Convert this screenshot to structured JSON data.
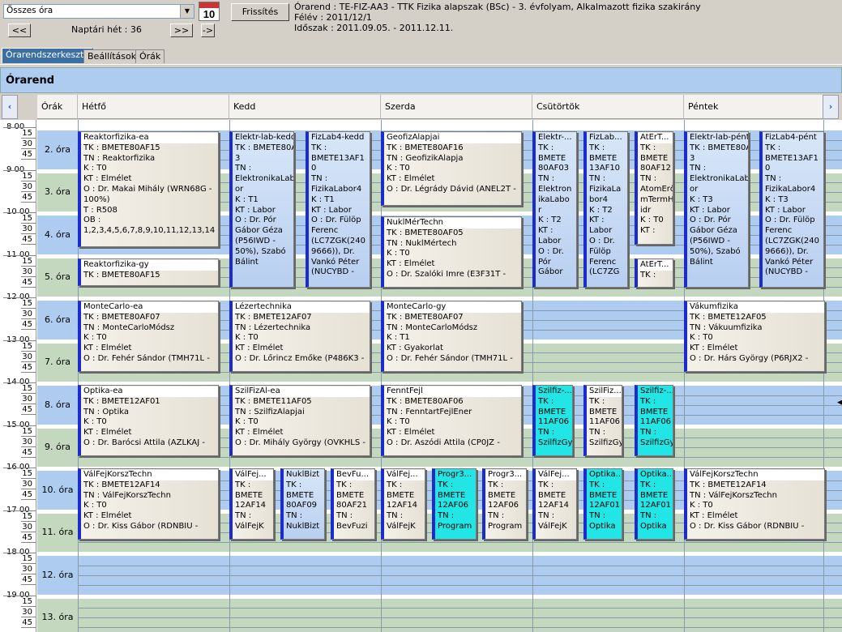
{
  "toolbar": {
    "selector_value": "Összes óra",
    "calendar_day": "10",
    "refresh_label": "Frissítés",
    "prev_label": "<<",
    "week_label": "Naptári hét : 36",
    "next_label": ">>",
    "last_label": "->"
  },
  "info": {
    "line1": "Órarend : TE-FIZ-AA3 - TTK Fizika alapszak (BSc) - 3. évfolyam, Alkalmazott fizika szakirány",
    "line2": "Félév : 2011/12/1",
    "line3": "Időszak : 2011.09.05. - 2011.12.11."
  },
  "tabs": [
    "Órarendszerkesztő",
    "Beállítások",
    "Órák"
  ],
  "title": "Órarend",
  "headers": {
    "oras": "Órák",
    "days": [
      "Hétfő",
      "Kedd",
      "Szerda",
      "Csütörtök",
      "Péntek"
    ]
  },
  "hours": [
    "8 00",
    "9 00",
    "10 00",
    "11 00",
    "12 00",
    "13 00",
    "14 00",
    "15 00",
    "16 00",
    "17 00",
    "18 00",
    "19 00"
  ],
  "quarters": [
    "15",
    "30",
    "45"
  ],
  "ora_labels": [
    "2. óra",
    "3. óra",
    "4. óra",
    "5. óra",
    "6. óra",
    "7. óra",
    "8. óra",
    "9. óra",
    "10. óra",
    "11. óra",
    "12. óra",
    "13. óra"
  ],
  "events": [
    {
      "id": "e1",
      "style": "w",
      "title": "Reaktorfizika-ea",
      "lines": [
        "TK : BMETE80AF15",
        "TN : Reaktorfizika",
        "K : T0",
        "KT : Elmélet",
        "O : Dr. Makai Mihály (WRN68G -",
        "100%)",
        "T : R508",
        "OB :",
        "1,2,3,4,5,6,7,8,9,10,11,12,13,14"
      ]
    },
    {
      "id": "e2",
      "style": "w",
      "title": "Reaktorfizika-gy",
      "lines": [
        "TK : BMETE80AF15"
      ]
    },
    {
      "id": "e3",
      "style": "b",
      "title": "Elektr-lab-kedd",
      "lines": [
        "TK : BMETE80AF0",
        "3",
        "TN :",
        "ElektronikaLab",
        "or",
        "K : T1",
        "KT : Labor",
        "O : Dr. Pór",
        "Gábor Géza",
        "(P56IWD -",
        "50%), Szabó",
        "Bálint"
      ]
    },
    {
      "id": "e4",
      "style": "b",
      "title": "FizLab4-kedd",
      "lines": [
        "TK :",
        "BMETE13AF1",
        "0",
        "TN :",
        "FizikaLabor4",
        "K : T1",
        "KT : Labor",
        "O : Dr. Fülöp",
        "Ferenc",
        "(LC7ZGK(240",
        "9666)), Dr.",
        "Vankó Péter",
        "(NUCYBD -"
      ]
    },
    {
      "id": "e5",
      "style": "w",
      "title": "GeofizAlapjai",
      "lines": [
        "TK : BMETE80AF16",
        "TN : GeofizikAlapja",
        "K : T0",
        "KT : Elmélet",
        "O : Dr. Légrády Dávid (ANEL2T -"
      ]
    },
    {
      "id": "e6",
      "style": "w",
      "title": "NuklMérTechn",
      "lines": [
        "TK : BMETE80AF05",
        "TN : NuklMértech",
        "K : T0",
        "KT : Elmélet",
        "O : Dr. Szalóki Imre (E3F31T -"
      ]
    },
    {
      "id": "e7",
      "style": "b",
      "title": "Elektr-...",
      "lines": [
        "TK :",
        "BMETE",
        "80AF03",
        "TN :",
        "Elektron",
        "ikaLabo",
        "r",
        "K : T2",
        "KT :",
        "Labor",
        "O : Dr.",
        "Pór",
        "Gábor"
      ]
    },
    {
      "id": "e8",
      "style": "b",
      "title": "FizLab...",
      "lines": [
        "TK :",
        "BMETE",
        "13AF10",
        "TN :",
        "FizikaLa",
        "bor4",
        "K : T2",
        "KT :",
        "Labor",
        "O : Dr.",
        "Fülöp",
        "Ferenc",
        "(LC7ZG"
      ]
    },
    {
      "id": "e9",
      "style": "w",
      "title": "AtErT...",
      "lines": [
        "TK :",
        "BMETE",
        "80AF12",
        "TN :",
        "AtomErő",
        "mTermH",
        "idr",
        "K : T0",
        "KT :"
      ]
    },
    {
      "id": "e10",
      "style": "w",
      "title": "AtErT...",
      "lines": [
        "TK :"
      ]
    },
    {
      "id": "e11",
      "style": "b",
      "title": "Elektr-lab-pént",
      "lines": [
        "TK : BMETE80AF0",
        "3",
        "TN :",
        "ElektronikaLab",
        "or",
        "K : T3",
        "KT : Labor",
        "O : Dr. Pór",
        "Gábor Géza",
        "(P56IWD -",
        "50%), Szabó",
        "Bálint"
      ]
    },
    {
      "id": "e12",
      "style": "b",
      "title": "FizLab4-pént",
      "lines": [
        "TK :",
        "BMETE13AF1",
        "0",
        "TN :",
        "FizikaLabor4",
        "K : T3",
        "KT : Labor",
        "O : Dr. Fülöp",
        "Ferenc",
        "(LC7ZGK(240",
        "9666)), Dr.",
        "Vankó Péter",
        "(NUCYBD -"
      ]
    },
    {
      "id": "e13",
      "style": "w",
      "title": "MonteCarlo-ea",
      "lines": [
        "TK : BMETE80AF07",
        "TN : MonteCarloMódsz",
        "K : T0",
        "KT : Elmélet",
        "O : Dr. Fehér Sándor (TMH71L -"
      ]
    },
    {
      "id": "e14",
      "style": "w",
      "title": "Lézertechnika",
      "lines": [
        "TK : BMETE12AF07",
        "TN : Lézertechnika",
        "K : T0",
        "KT : Elmélet",
        "O : Dr. Lőrincz Emőke (P486K3 -"
      ]
    },
    {
      "id": "e15",
      "style": "w",
      "title": "MonteCarlo-gy",
      "lines": [
        "TK : BMETE80AF07",
        "TN : MonteCarloMódsz",
        "K : T1",
        "KT : Gyakorlat",
        "O : Dr. Fehér Sándor (TMH71L -"
      ]
    },
    {
      "id": "e16",
      "style": "w",
      "title": "Vákumfizika",
      "lines": [
        "TK : BMETE12AF05",
        "TN : Vákuumfizika",
        "K : T0",
        "KT : Elmélet",
        "O : Dr. Hárs György (P6RJX2 -"
      ]
    },
    {
      "id": "e17",
      "style": "w",
      "title": "Optika-ea",
      "lines": [
        "TK : BMETE12AF01",
        "TN : Optika",
        "K : T0",
        "KT : Elmélet",
        "O : Dr. Barócsi Attila (AZLKAJ -"
      ]
    },
    {
      "id": "e18",
      "style": "w",
      "title": "SzilFizAl-ea",
      "lines": [
        "TK : BMETE11AF05",
        "TN : SzilfizAlapjai",
        "K : T0",
        "KT : Elmélet",
        "O : Dr. Mihály György (OVKHLS -"
      ]
    },
    {
      "id": "e19",
      "style": "w",
      "title": "FenntFejl",
      "lines": [
        "TK : BMETE80AF06",
        "TN : FenntartFejlEner",
        "K : T0",
        "KT : Elmélet",
        "O : Dr. Aszódi Attila (CP0JZ -"
      ]
    },
    {
      "id": "e20",
      "style": "c",
      "title": "Szilfiz-...",
      "lines": [
        "TK :",
        "BMETE",
        "11AF06",
        "TN :",
        "SzilfizGy"
      ]
    },
    {
      "id": "e21",
      "style": "w",
      "title": "SzilFiz...",
      "lines": [
        "TK :",
        "BMETE",
        "11AF06",
        "TN :",
        "SzilfizGy"
      ]
    },
    {
      "id": "e22",
      "style": "c",
      "title": "Szilfiz-...",
      "lines": [
        "TK :",
        "BMETE",
        "11AF06",
        "TN :",
        "SzilfizGy"
      ]
    },
    {
      "id": "e23",
      "style": "w",
      "title": "VálFejKorszTechn",
      "lines": [
        "TK : BMETE12AF14",
        "TN : VálFejKorszTechn",
        "K : T0",
        "KT : Elmélet",
        "O : Dr. Kiss Gábor (RDNBIU -"
      ]
    },
    {
      "id": "e24",
      "style": "w",
      "title": "VálFej...",
      "lines": [
        "TK :",
        "BMETE",
        "12AF14",
        "TN :",
        "VálFejK"
      ]
    },
    {
      "id": "e25",
      "style": "b",
      "title": "NuklBizt",
      "lines": [
        "TK :",
        "BMETE",
        "80AF09",
        "TN :",
        "NuklBizt"
      ]
    },
    {
      "id": "e26",
      "style": "w",
      "title": "BevFu...",
      "lines": [
        "TK :",
        "BMETE",
        "80AF21",
        "TN :",
        "BevFuzi"
      ]
    },
    {
      "id": "e27",
      "style": "w",
      "title": "VálFej...",
      "lines": [
        "TK :",
        "BMETE",
        "12AF14",
        "TN :",
        "VálFejK"
      ]
    },
    {
      "id": "e28",
      "style": "c",
      "title": "Progr3...",
      "lines": [
        "TK :",
        "BMETE",
        "12AF06",
        "TN :",
        "Program"
      ]
    },
    {
      "id": "e29",
      "style": "w",
      "title": "Progr3...",
      "lines": [
        "TK :",
        "BMETE",
        "12AF06",
        "TN :",
        "Program"
      ]
    },
    {
      "id": "e30",
      "style": "w",
      "title": "VálFej...",
      "lines": [
        "TK :",
        "BMETE",
        "12AF14",
        "TN :",
        "VálFejK"
      ]
    },
    {
      "id": "e31",
      "style": "c",
      "title": "Optika...",
      "lines": [
        "TK :",
        "BMETE",
        "12AF01",
        "TN :",
        "Optika"
      ]
    },
    {
      "id": "e32",
      "style": "c",
      "title": "Optika...",
      "lines": [
        "TK :",
        "BMETE",
        "12AF01",
        "TN :",
        "Optika"
      ]
    },
    {
      "id": "e33",
      "style": "w",
      "title": "VálFejKorszTechn",
      "lines": [
        "TK : BMETE12AF14",
        "TN : VálFejKorszTechn",
        "K : T0",
        "KT : Elmélet",
        "O : Dr. Kiss Gábor (RDNBIU -"
      ]
    }
  ],
  "colors": {
    "blue_band": "#aecbf0",
    "green_band": "#c4d8c0",
    "event_border": "#1c2ccc",
    "cyan": "#22e6e6"
  }
}
